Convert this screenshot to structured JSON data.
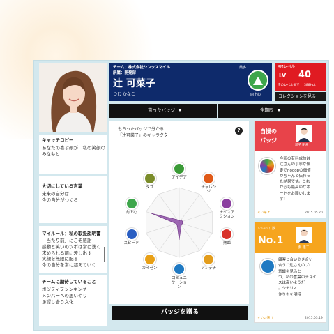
{
  "profile": {
    "team_line": "チーム：株式会社シンクスマイル",
    "dept_line": "所属：開発部",
    "name": "辻 可菜子",
    "kana": "つじ かなこ",
    "top_badge_caption": "最多",
    "top_badge_name": "向上心"
  },
  "level": {
    "title": "RMレベル",
    "lv_label": "LV",
    "value": "40",
    "next_label": "次のレベルまで",
    "next_value": "388Hpt",
    "collection_button": "コレクションを見る"
  },
  "tabs": {
    "received": "貰ったバッジ",
    "period": "全期間"
  },
  "left": {
    "catch_title": "キャッチコピー",
    "catch_body": "あなたの喜ぶ顔が　私の笑顔の\nみなもと",
    "motto_title": "大切にしている言葉",
    "motto_body": "未来の自分は\n今の自分がつくる",
    "rule_title": "マイルール：私の取扱説明書",
    "rule_body": "「当たり前」にこそ感謝\n感動と笑いのツボは常に浅く\n求められる前に差し出す\n笑顔を無限に配る\n今の自分を常に超えていく",
    "expect_title": "チームに期待していること",
    "expect_body": "ポジティブシンキング\nメンバーへの思いやり\n承認し合う文化"
  },
  "chart": {
    "caption_line1": "もらったバッジで分かる",
    "caption_line2": "「辻可菜子」のキャラクター",
    "help": "?",
    "send_button": "バッジを贈る"
  },
  "chart_data": {
    "type": "radar",
    "categories": [
      "アイデア",
      "チャレンジ",
      "ナイスアクション",
      "熱血",
      "アンテナ",
      "コミュニケーション",
      "カイゼン",
      "スピード",
      "向上心",
      "タフ"
    ],
    "values": [
      0.05,
      0.1,
      0.1,
      0.1,
      0.1,
      0.5,
      0.1,
      0.1,
      0.85,
      0.1
    ],
    "max": 1,
    "colors": {
      "fill": "#8e4fa8",
      "grid": "#d6d6d6"
    }
  },
  "badges": [
    {
      "label": "アイデア",
      "color": "#3a9a36",
      "icon": "lightbulb-icon"
    },
    {
      "label": "チャレン\nジ",
      "color": "#e05a18",
      "icon": "flag-icon"
    },
    {
      "label": "ナイスア\nクション",
      "color": "#8b3fa0",
      "icon": "thumbs-up-icon"
    },
    {
      "label": "熱血",
      "color": "#d8322a",
      "icon": "fire-icon"
    },
    {
      "label": "アンテナ",
      "color": "#e39d1d",
      "icon": "antenna-icon"
    },
    {
      "label": "コミュニ\nケーショ\nン",
      "color": "#1f79c2",
      "icon": "chat-icon"
    },
    {
      "label": "カイゼン",
      "color": "#e8a016",
      "icon": "wrench-icon"
    },
    {
      "label": "スピード",
      "color": "#2a5ec2",
      "icon": "speed-icon"
    },
    {
      "label": "向上心",
      "color": "#3ea64b",
      "icon": "growth-icon"
    },
    {
      "label": "タフ",
      "color": "#7a8c2a",
      "icon": "muscle-icon"
    }
  ],
  "proud": {
    "title1": "自慢の",
    "title2": "バッジ",
    "giver": "新子 明希",
    "body": "今回の有料成約は\n辻さんの丁寧な伴\n走でhooopの価値\nがちゃんと伝わっ\nた結果です。これ\nからも最高のサポ\nートをお願いしま\nす！",
    "footer_left": "ぐい帰 ↑",
    "date": "2015.05.20"
  },
  "likes": {
    "label": "いいね！数",
    "value": "No.1",
    "giver": "後 雄二",
    "body": "顧客と合い向き合い\n合うこ辻さんのプロ\n意識を見ると\nつ、私の言葉のチョイ\nスは高いようだ\n。シナリオ\n作りもを明待",
    "footer_left": "ぐいい帰 ↑",
    "date": "2015.03.19"
  }
}
